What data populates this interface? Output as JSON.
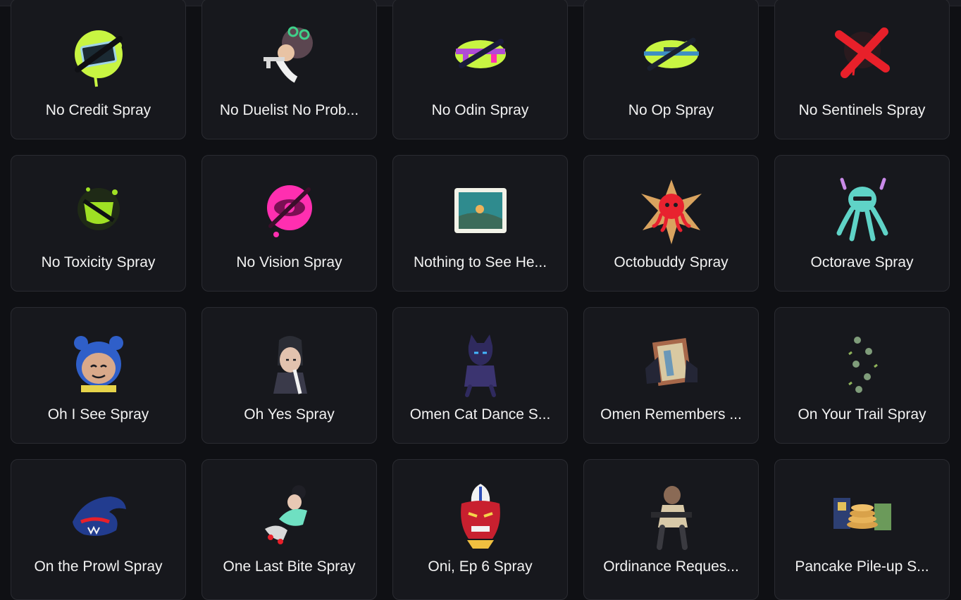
{
  "cards": [
    {
      "label": "No Credit Spray",
      "icon": "no-credit-spray-icon"
    },
    {
      "label": "No Duelist No Prob...",
      "icon": "no-duelist-spray-icon"
    },
    {
      "label": "No Odin Spray",
      "icon": "no-odin-spray-icon"
    },
    {
      "label": "No Op Spray",
      "icon": "no-op-spray-icon"
    },
    {
      "label": "No Sentinels Spray",
      "icon": "no-sentinels-spray-icon"
    },
    {
      "label": "No Toxicity Spray",
      "icon": "no-toxicity-spray-icon"
    },
    {
      "label": "No Vision Spray",
      "icon": "no-vision-spray-icon"
    },
    {
      "label": "Nothing to See He...",
      "icon": "nothing-to-see-spray-icon"
    },
    {
      "label": "Octobuddy Spray",
      "icon": "octobuddy-spray-icon"
    },
    {
      "label": "Octorave Spray",
      "icon": "octorave-spray-icon"
    },
    {
      "label": "Oh I See Spray",
      "icon": "oh-i-see-spray-icon"
    },
    {
      "label": "Oh Yes Spray",
      "icon": "oh-yes-spray-icon"
    },
    {
      "label": "Omen Cat Dance S...",
      "icon": "omen-cat-dance-spray-icon"
    },
    {
      "label": "Omen Remembers ...",
      "icon": "omen-remembers-spray-icon"
    },
    {
      "label": "On Your Trail Spray",
      "icon": "on-your-trail-spray-icon"
    },
    {
      "label": "On the Prowl Spray",
      "icon": "on-the-prowl-spray-icon"
    },
    {
      "label": "One Last Bite Spray",
      "icon": "one-last-bite-spray-icon"
    },
    {
      "label": "Oni, Ep 6 Spray",
      "icon": "oni-spray-icon"
    },
    {
      "label": "Ordinance Reques...",
      "icon": "ordinance-request-spray-icon"
    },
    {
      "label": "Pancake Pile-up S...",
      "icon": "pancake-pileup-spray-icon"
    }
  ],
  "colors": {
    "background": "#0f1014",
    "card": "#17181d",
    "card_border": "#2a2b31",
    "text": "#f2f2f2",
    "lime": "#c8f542",
    "magenta": "#ff2fb0",
    "red": "#e8202a"
  }
}
